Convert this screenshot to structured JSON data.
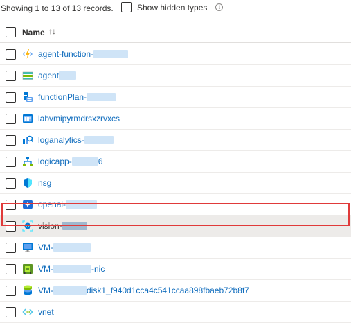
{
  "toolbar": {
    "records_text": "Showing 1 to 13 of 13 records.",
    "show_hidden_label": "Show hidden types",
    "info_glyph": "i"
  },
  "table": {
    "header": {
      "name_label": "Name",
      "sort_glyph": "↑↓"
    },
    "rows": [
      {
        "icon": "function-app-icon",
        "prefix": "agent-function-",
        "suffix": "",
        "redacted": true
      },
      {
        "icon": "storage-account-icon",
        "prefix": "agent",
        "suffix": "",
        "redacted": true
      },
      {
        "icon": "app-service-plan-icon",
        "prefix": "functionPlan-",
        "suffix": "",
        "redacted": true
      },
      {
        "icon": "container-registry-icon",
        "prefix": "labvmipyrmdrsxzrvxcs",
        "suffix": "",
        "redacted": false
      },
      {
        "icon": "log-analytics-icon",
        "prefix": "loganalytics-",
        "suffix": "",
        "redacted": true
      },
      {
        "icon": "logic-app-icon",
        "prefix": "logicapp-",
        "suffix": "6",
        "redacted": true
      },
      {
        "icon": "nsg-shield-icon",
        "prefix": "nsg",
        "suffix": "",
        "redacted": false
      },
      {
        "icon": "openai-icon",
        "prefix": "openai-",
        "suffix": "",
        "redacted": true
      },
      {
        "icon": "computer-vision-icon",
        "prefix": "vision-",
        "suffix": "",
        "redacted": true,
        "selected": true
      },
      {
        "icon": "virtual-machine-icon",
        "prefix": "VM-",
        "suffix": "",
        "redacted": true
      },
      {
        "icon": "network-interface-icon",
        "prefix": "VM-",
        "suffix": "-nic",
        "redacted": true
      },
      {
        "icon": "disk-icon",
        "prefix": "VM-",
        "suffix": "disk1_f940d1cca4c541ccaa898fbaeb72b8f7",
        "redacted": true
      },
      {
        "icon": "virtual-network-icon",
        "prefix": "vnet",
        "suffix": "",
        "redacted": false
      }
    ]
  },
  "colors": {
    "link": "#0f6cbd",
    "highlight": "#e03a3a",
    "selected_row": "#edebe9"
  }
}
